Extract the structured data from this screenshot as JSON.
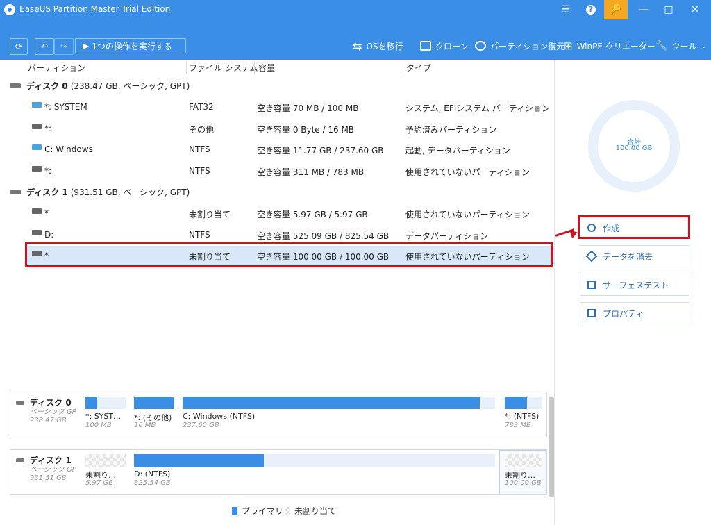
{
  "window": {
    "title": "EaseUS Partition Master Trial Edition"
  },
  "toolbar": {
    "execute_label": "1つの操作を実行する",
    "os_migrate": "OSを移行",
    "clone": "クローン",
    "partition_recovery": "パーティション復元",
    "winpe": "WinPE クリエーター",
    "tools": "ツール"
  },
  "columns": {
    "partition": "パーティション",
    "filesystem": "ファイル システム",
    "capacity": "容量",
    "type": "タイプ"
  },
  "disks": [
    {
      "title": "ディスク 0",
      "info": "(238.47 GB, ベーシック, GPT)",
      "partitions": [
        {
          "name": "*: SYSTEM",
          "fs": "FAT32",
          "cap": "空き容量 70 MB / 100 MB",
          "type": "システム, EFIシステム パーティション"
        },
        {
          "name": "*:",
          "fs": "その他",
          "cap": "空き容量 0 Byte / 16 MB",
          "type": "予約済みパーティション"
        },
        {
          "name": "C: Windows",
          "fs": "NTFS",
          "cap": "空き容量 11.77 GB / 237.60 GB",
          "type": "起動, データパーティション"
        },
        {
          "name": "*:",
          "fs": "NTFS",
          "cap": "空き容量 311 MB / 783 MB",
          "type": "使用されていないパーティション"
        }
      ]
    },
    {
      "title": "ディスク 1",
      "info": "(931.51 GB, ベーシック, GPT)",
      "partitions": [
        {
          "name": "*",
          "fs": "未割り当て",
          "cap": "空き容量 5.97 GB / 5.97 GB",
          "type": "使用されていないパーティション"
        },
        {
          "name": "D:",
          "fs": "NTFS",
          "cap": "空き容量 525.09 GB / 825.54 GB",
          "type": "データパーティション"
        },
        {
          "name": "*",
          "fs": "未割り当て",
          "cap": "空き容量 100.00 GB / 100.00 GB",
          "type": "使用されていないパーティション"
        }
      ]
    }
  ],
  "side": {
    "total_label": "合計",
    "total_value": "100.00 GB",
    "actions": [
      "作成",
      "データを消去",
      "サーフェステスト",
      "プロパティ"
    ]
  },
  "map": {
    "disk0": {
      "name": "ディスク 0",
      "kind": "ベーシック GP",
      "size": "238.47 GB",
      "segs": [
        {
          "label": "*: SYST…",
          "size": "100 MB",
          "used": 0.3
        },
        {
          "label": "*: (その他)",
          "size": "16 MB",
          "used": 1.0
        },
        {
          "label": "C: Windows (NTFS)",
          "size": "237.60 GB",
          "used": 0.95
        },
        {
          "label": "*: (NTFS)",
          "size": "783 MB",
          "used": 0.6
        }
      ]
    },
    "disk1": {
      "name": "ディスク 1",
      "kind": "ベーシック GP",
      "size": "931.51 GB",
      "segs": [
        {
          "label": "未割り…",
          "size": "5.97 GB"
        },
        {
          "label": "D: (NTFS)",
          "size": "825.54 GB",
          "used": 0.36
        },
        {
          "label": "未割り…",
          "size": "100.00 GB"
        }
      ]
    }
  },
  "legend": {
    "primary": "プライマリ",
    "unallocated": "未割り当て"
  },
  "colors": {
    "accent": "#3a8ee6",
    "highlight": "#d0101d",
    "selected_row": "#d8e8f8"
  }
}
